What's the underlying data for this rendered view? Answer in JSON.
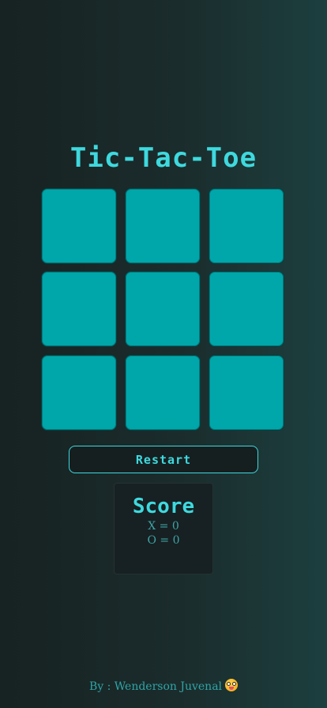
{
  "title": "Tic-Tac-Toe",
  "board": {
    "cells": [
      "",
      "",
      "",
      "",
      "",
      "",
      "",
      "",
      ""
    ]
  },
  "restart_label": "Restart",
  "score": {
    "title": "Score",
    "x_line": "X = 0",
    "o_line": "O = 0"
  },
  "footer": {
    "text": "By : Wenderson Juvenal",
    "emoji": "zany-face-icon"
  },
  "colors": {
    "accent": "#3ed9de",
    "cell": "#00a7aa",
    "panel": "#172022"
  }
}
